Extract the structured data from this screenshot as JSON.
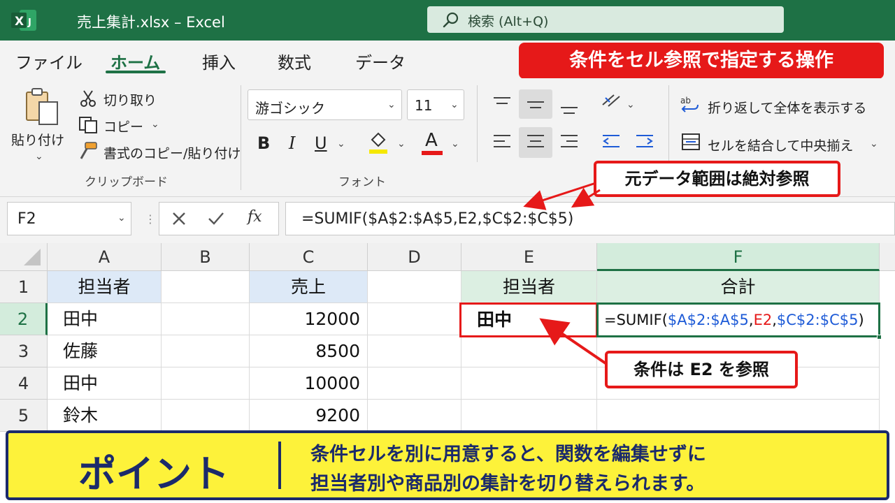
{
  "window": {
    "title": "売上集計.xlsx  –  Excel",
    "search_placeholder": "検索 (Alt+Q)"
  },
  "colors": {
    "excel_green": "#1e7145",
    "accent_red": "#e61919",
    "ref_blue": "#1e5bd7",
    "banner_yellow": "#fdf23a",
    "banner_navy": "#1b2a6b"
  },
  "tabs": [
    {
      "label": "ファイル"
    },
    {
      "label": "ホーム",
      "active": true
    },
    {
      "label": "挿入"
    },
    {
      "label": "数式"
    },
    {
      "label": "データ"
    }
  ],
  "banner": "条件をセル参照で指定する操作",
  "ribbon": {
    "clipboard": {
      "paste": "貼り付け",
      "cut": "切り取り",
      "copy": "コピー",
      "format_painter": "書式のコピー/貼り付け",
      "group": "クリップボード"
    },
    "font": {
      "name": "游ゴシック",
      "size": "11",
      "bold": "B",
      "italic": "I",
      "underline": "U",
      "font_color": "A",
      "group": "フォント"
    },
    "alignment": {
      "wrap": "折り返して全体を表示する",
      "merge": "セルを結合して中央揃え"
    }
  },
  "callouts": {
    "absolute": "元データ範囲は絶対参照",
    "condition": "条件は E2 を参照"
  },
  "formula_bar": {
    "name_box": "F2",
    "fx": "fx",
    "formula": "=SUMIF($A$2:$A$5,E2,$C$2:$C$5)"
  },
  "grid": {
    "columns": [
      "A",
      "B",
      "C",
      "D",
      "E",
      "F"
    ],
    "rows": [
      "1",
      "2",
      "3",
      "4",
      "5"
    ],
    "a1": "担当者",
    "c1": "売上",
    "e1": "担当者",
    "f1": "合計",
    "data": [
      {
        "name": "田中",
        "sales": "12000"
      },
      {
        "name": "佐藤",
        "sales": "8500"
      },
      {
        "name": "田中",
        "sales": "10000"
      },
      {
        "name": "鈴木",
        "sales": "9200"
      }
    ],
    "e2": "田中",
    "f2_parts": [
      "=SUMIF(",
      "$A$2:$A$5",
      ",",
      "E2",
      ",",
      "$C$2:$C$5",
      ")"
    ]
  },
  "point": {
    "title": "ポイント",
    "line1": "条件セルを別に用意すると、関数を編集せずに",
    "line2": "担当者別や商品別の集計を切り替えられます。"
  }
}
